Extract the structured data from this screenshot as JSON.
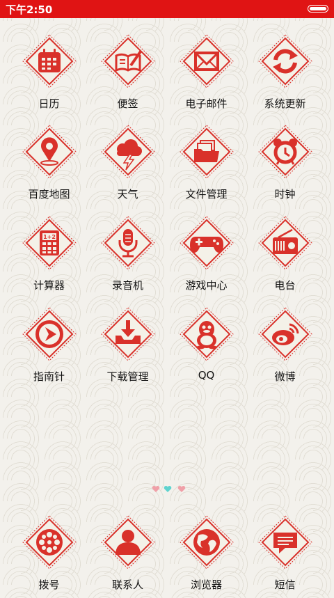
{
  "status_bar": {
    "time": "下午2:50"
  },
  "apps": [
    {
      "label": "日历",
      "icon": "calendar-icon"
    },
    {
      "label": "便签",
      "icon": "notebook-icon"
    },
    {
      "label": "电子邮件",
      "icon": "mail-icon"
    },
    {
      "label": "系统更新",
      "icon": "refresh-icon"
    },
    {
      "label": "百度地图",
      "icon": "map-pin-icon"
    },
    {
      "label": "天气",
      "icon": "storm-cloud-icon"
    },
    {
      "label": "文件管理",
      "icon": "folder-icon"
    },
    {
      "label": "时钟",
      "icon": "alarm-clock-icon"
    },
    {
      "label": "计算器",
      "icon": "calculator-icon"
    },
    {
      "label": "录音机",
      "icon": "microphone-icon"
    },
    {
      "label": "游戏中心",
      "icon": "gamepad-icon"
    },
    {
      "label": "电台",
      "icon": "radio-icon"
    },
    {
      "label": "指南针",
      "icon": "compass-icon"
    },
    {
      "label": "下载管理",
      "icon": "download-icon"
    },
    {
      "label": "QQ",
      "icon": "penguin-icon"
    },
    {
      "label": "微博",
      "icon": "weibo-icon"
    }
  ],
  "dock": [
    {
      "label": "拨号",
      "icon": "dialer-icon"
    },
    {
      "label": "联系人",
      "icon": "contact-icon"
    },
    {
      "label": "浏览器",
      "icon": "globe-icon"
    },
    {
      "label": "短信",
      "icon": "message-icon"
    }
  ],
  "page_indicator": {
    "count": 3,
    "active_index": 1
  },
  "colors": {
    "accent": "#e01414",
    "icon_red": "#d9312a",
    "tile": "#f4f1e8",
    "active_dot": "#5fd3cf",
    "inactive_dot": "#f0a0a8"
  }
}
